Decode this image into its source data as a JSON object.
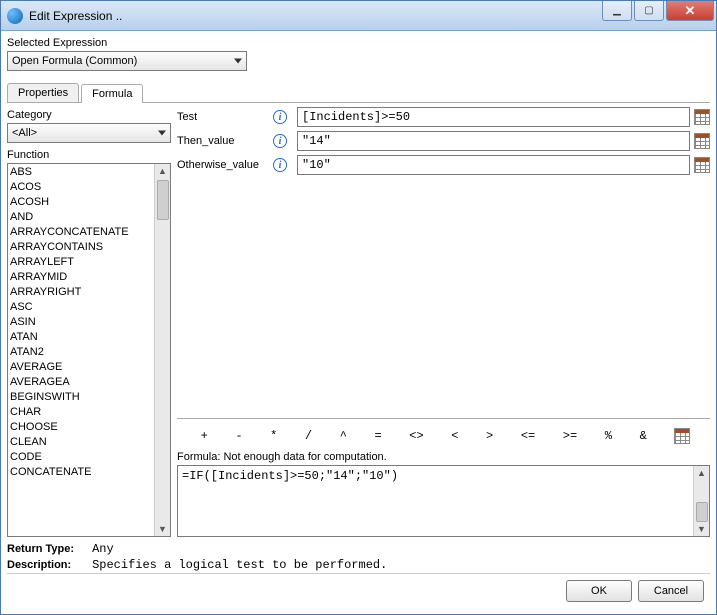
{
  "window": {
    "title": "Edit Expression .."
  },
  "selected_expression": {
    "label": "Selected Expression",
    "value": "Open Formula (Common)"
  },
  "tabs": {
    "properties": "Properties",
    "formula": "Formula"
  },
  "left": {
    "category_label": "Category",
    "category_value": "<All>",
    "function_label": "Function",
    "functions": [
      "ABS",
      "ACOS",
      "ACOSH",
      "AND",
      "ARRAYCONCATENATE",
      "ARRAYCONTAINS",
      "ARRAYLEFT",
      "ARRAYMID",
      "ARRAYRIGHT",
      "ASC",
      "ASIN",
      "ATAN",
      "ATAN2",
      "AVERAGE",
      "AVERAGEA",
      "BEGINSWITH",
      "CHAR",
      "CHOOSE",
      "CLEAN",
      "CODE",
      "CONCATENATE"
    ]
  },
  "params": {
    "test": {
      "label": "Test",
      "value": "[Incidents]>=50"
    },
    "then": {
      "label": "Then_value",
      "value": "\"14\""
    },
    "otherwise": {
      "label": "Otherwise_value",
      "value": "\"10\""
    }
  },
  "operators": [
    "+",
    "-",
    "*",
    "/",
    "^",
    "=",
    "<>",
    "<",
    ">",
    "<=",
    ">=",
    "%",
    "&"
  ],
  "formula": {
    "status": "Formula: Not enough data for computation.",
    "text": "=IF([Incidents]>=50;\"14\";\"10\")"
  },
  "meta": {
    "return_type_label": "Return Type:",
    "return_type_value": "Any",
    "description_label": "Description:",
    "description_value": "Specifies a logical test to be performed."
  },
  "buttons": {
    "ok": "OK",
    "cancel": "Cancel"
  }
}
